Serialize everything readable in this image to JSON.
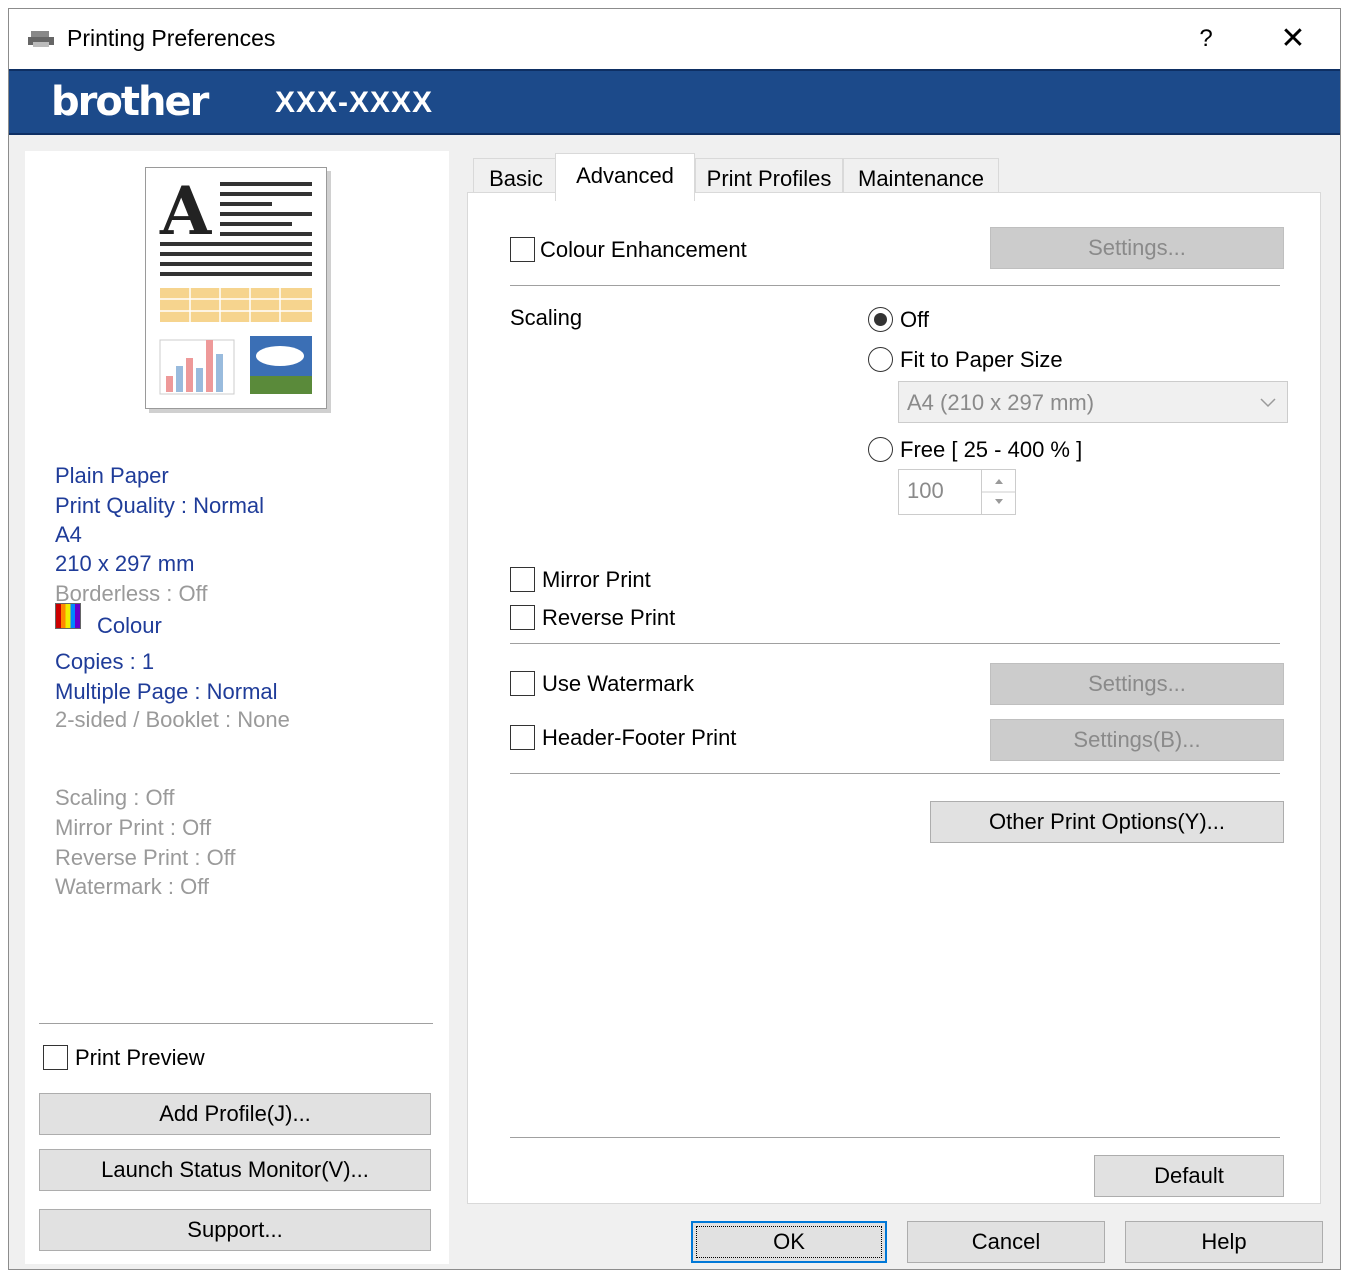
{
  "window": {
    "title": "Printing Preferences",
    "help_symbol": "?",
    "close_symbol": "✕",
    "brand": "brother",
    "model": "XXX-XXXX"
  },
  "summary": {
    "media": "Plain Paper",
    "quality": "Print Quality : Normal",
    "size": "A4",
    "dimensions": "210 x 297 mm",
    "borderless": "Borderless : Off",
    "colour": "Colour",
    "copies": "Copies : 1",
    "multiple_page": "Multiple Page : Normal",
    "two_sided": "2-sided / Booklet : None",
    "scaling": "Scaling : Off",
    "mirror": "Mirror Print : Off",
    "reverse": "Reverse Print : Off",
    "watermark": "Watermark : Off"
  },
  "left_controls": {
    "print_preview": "Print Preview",
    "add_profile": "Add Profile(J)...",
    "launch_status": "Launch Status Monitor(V)...",
    "support": "Support..."
  },
  "tabs": [
    "Basic",
    "Advanced",
    "Print Profiles",
    "Maintenance"
  ],
  "active_tab": "Advanced",
  "advanced": {
    "colour_enhancement": "Colour Enhancement",
    "settings": "Settings...",
    "scaling_label": "Scaling",
    "scaling_off": "Off",
    "fit_to_paper": "Fit to Paper Size",
    "paper_select": "A4 (210 x 297 mm)",
    "free": "Free [ 25 - 400 % ]",
    "free_value": "100",
    "mirror_print": "Mirror Print",
    "reverse_print": "Reverse Print",
    "use_watermark": "Use Watermark",
    "watermark_settings": "Settings...",
    "header_footer": "Header-Footer Print",
    "header_footer_settings": "Settings(B)...",
    "other_options": "Other Print Options(Y)...",
    "default": "Default"
  },
  "dialog_buttons": {
    "ok": "OK",
    "cancel": "Cancel",
    "help": "Help"
  }
}
